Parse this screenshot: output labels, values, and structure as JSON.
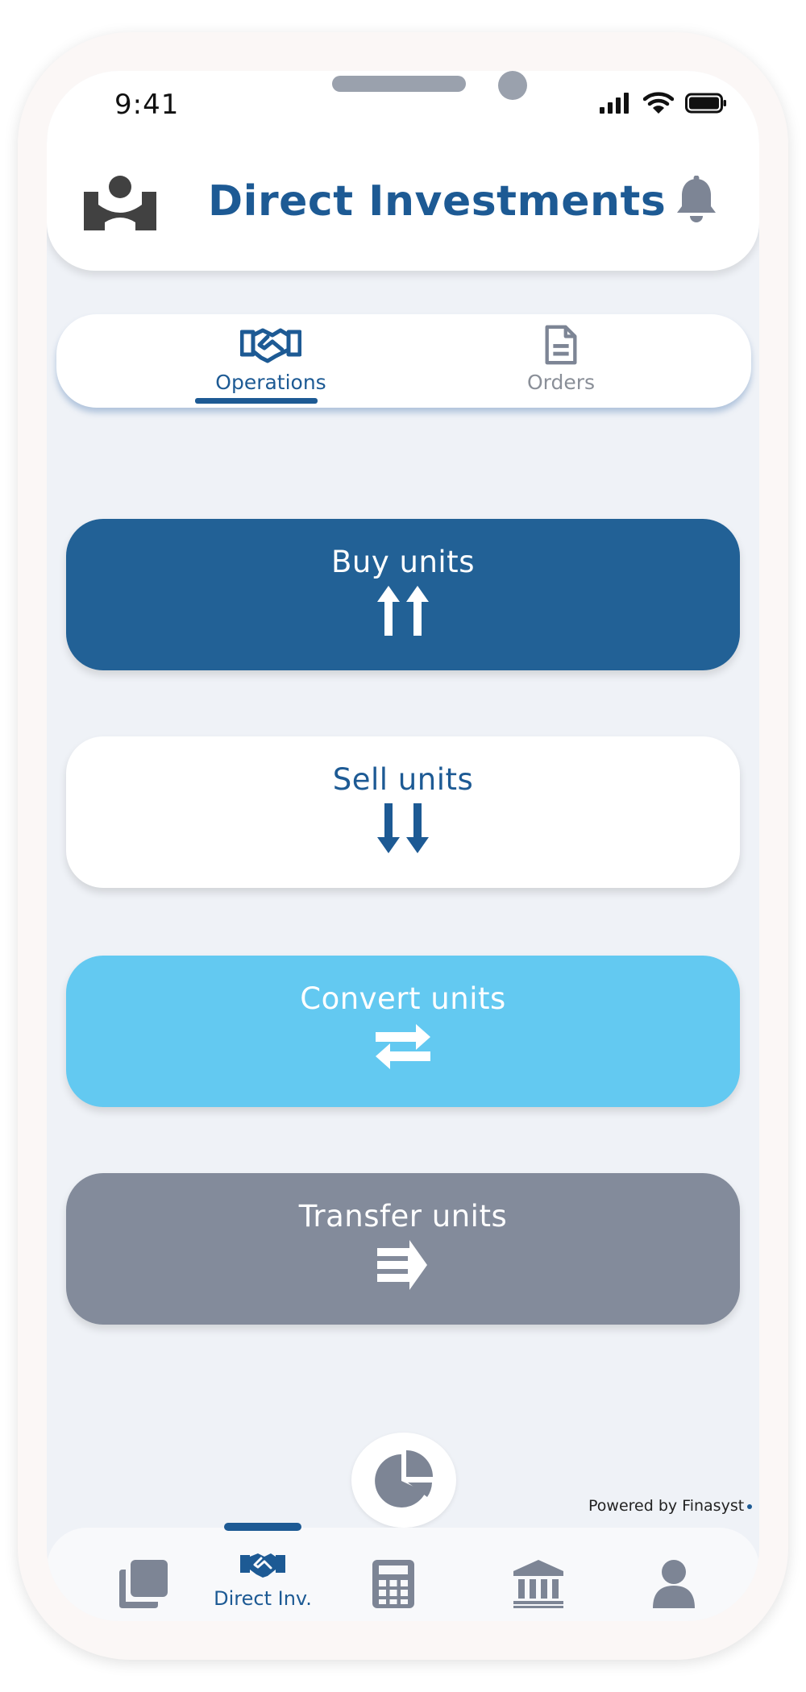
{
  "status_bar": {
    "time": "9:41"
  },
  "header": {
    "title": "Direct Investments"
  },
  "tabs": [
    {
      "label": "Operations",
      "icon": "handshake-icon",
      "active": true
    },
    {
      "label": "Orders",
      "icon": "document-icon",
      "active": false
    }
  ],
  "actions": [
    {
      "label": "Buy units",
      "icon": "double-arrow-up-icon",
      "color": "#226196"
    },
    {
      "label": "Sell units",
      "icon": "double-arrow-down-icon",
      "color": "#ffffff"
    },
    {
      "label": "Convert units",
      "icon": "swap-arrows-icon",
      "color": "#63c9f1"
    },
    {
      "label": "Transfer units",
      "icon": "transfer-arrows-icon",
      "color": "#838b9b"
    }
  ],
  "fab": {
    "icon": "pie-chart-icon"
  },
  "footer": {
    "powered_by": "Powered by Finasyst"
  },
  "bottom_nav": [
    {
      "icon": "cards-icon",
      "label": "",
      "active": false
    },
    {
      "icon": "handshake-icon",
      "label": "Direct Inv.",
      "active": true
    },
    {
      "icon": "calculator-icon",
      "label": "",
      "active": false
    },
    {
      "icon": "bank-icon",
      "label": "",
      "active": false
    },
    {
      "icon": "user-icon",
      "label": "",
      "active": false
    }
  ],
  "colors": {
    "primary": "#1d5a94",
    "accent": "#63c9f1",
    "muted": "#838b9b",
    "background": "#eff2f7"
  }
}
